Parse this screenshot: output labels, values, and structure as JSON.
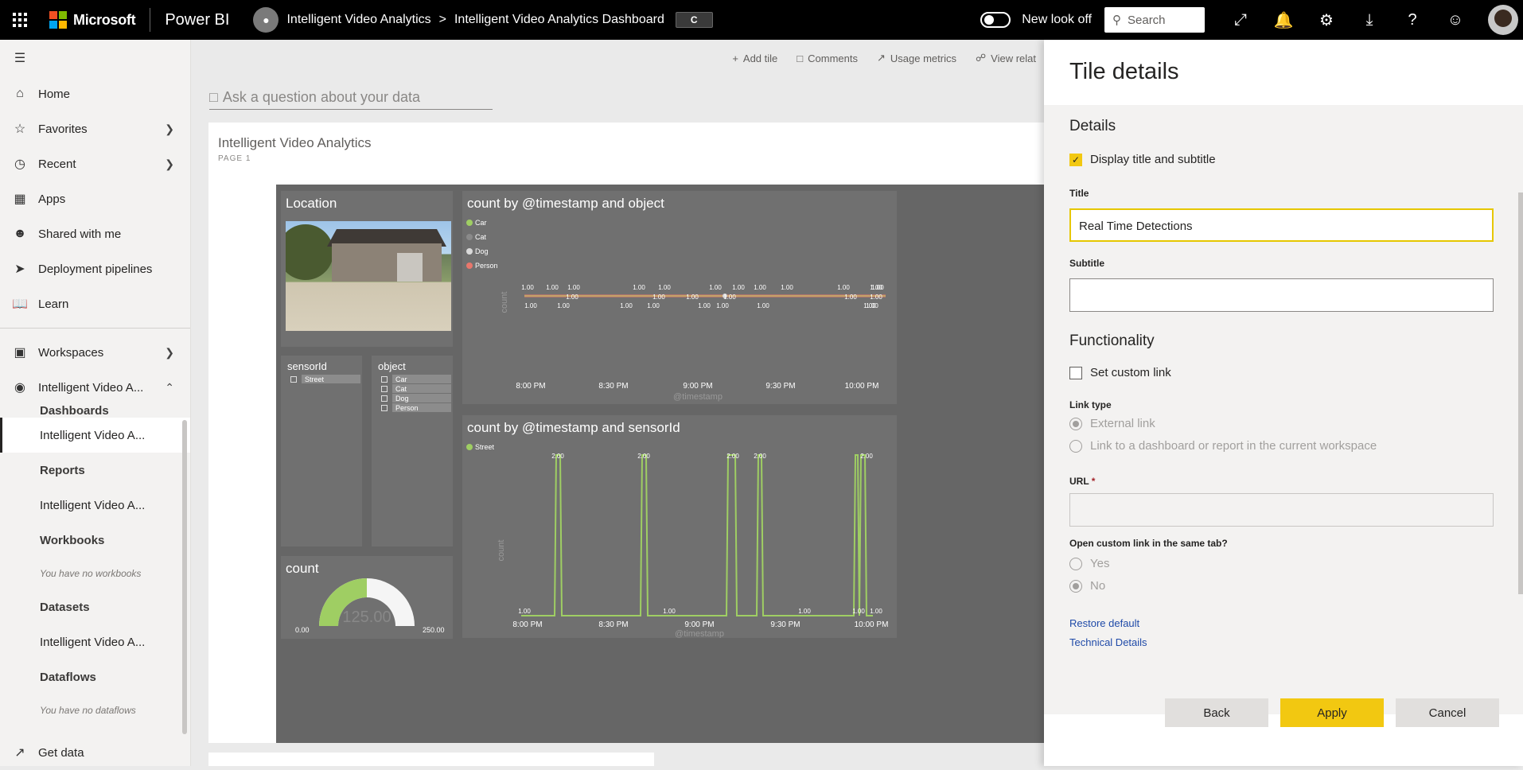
{
  "topbar": {
    "brand": "Microsoft",
    "product": "Power BI",
    "workspace": "Intelligent Video Analytics",
    "separator": ">",
    "dashboard": "Intelligent Video Analytics Dashboard",
    "badge": "C",
    "new_look_label": "New look off",
    "search_placeholder": "Search"
  },
  "nav": {
    "home": "Home",
    "favorites": "Favorites",
    "recent": "Recent",
    "apps": "Apps",
    "shared": "Shared with me",
    "pipelines": "Deployment pipelines",
    "learn": "Learn",
    "workspaces": "Workspaces",
    "current_ws": "Intelligent Video A...",
    "dashboards_head": "Dashboards",
    "dashboard_item": "Intelligent Video A...",
    "reports_head": "Reports",
    "report_item": "Intelligent Video A...",
    "workbooks_head": "Workbooks",
    "workbooks_note": "You have no workbooks",
    "datasets_head": "Datasets",
    "dataset_item": "Intelligent Video A...",
    "dataflows_head": "Dataflows",
    "dataflows_note": "You have no dataflows",
    "get_data": "Get data"
  },
  "actions": {
    "add_tile": "Add tile",
    "comments": "Comments",
    "usage": "Usage metrics",
    "view_related": "View relat"
  },
  "ask_placeholder": "Ask a question about your data",
  "report": {
    "title": "Intelligent Video Analytics",
    "page": "PAGE 1",
    "location_title": "Location",
    "sensor_title": "sensorId",
    "sensor_items": [
      "Street"
    ],
    "object_title": "object",
    "object_items": [
      "Car",
      "Cat",
      "Dog",
      "Person"
    ],
    "count_title": "count",
    "gauge_min": "0.00",
    "gauge_max": "250.00",
    "gauge_value_label": "125.00"
  },
  "chart_data": [
    {
      "type": "line",
      "title": "count by @timestamp and object",
      "xlabel": "@timestamp",
      "ylabel": "count",
      "x_ticks": [
        "8:00 PM",
        "8:30 PM",
        "9:00 PM",
        "9:30 PM",
        "10:00 PM"
      ],
      "series": [
        {
          "name": "Car",
          "color": "#9fce63"
        },
        {
          "name": "Cat",
          "color": "#8a8a8a"
        },
        {
          "name": "Dog",
          "color": "#d9d9d9"
        },
        {
          "name": "Person",
          "color": "#e8776c"
        }
      ],
      "upper_point_labels": [
        "1.00",
        "1.00",
        "1.00",
        "1.00",
        "1.00",
        "1.00",
        "1.00",
        "1.00",
        "1.00",
        "1.00",
        "1.00",
        "1.00"
      ],
      "middle_point_labels": [
        "1.00",
        "1.00",
        "1.00",
        "1.00",
        "1.00",
        "1.00"
      ],
      "lower_point_labels": [
        "1.00",
        "1.00",
        "1.00",
        "1.00",
        "1.00",
        "1.00",
        "1.00",
        "1.00",
        "1.00"
      ],
      "legend": "top-left"
    },
    {
      "type": "line",
      "title": "count by @timestamp and sensorId",
      "xlabel": "@timestamp",
      "ylabel": "count",
      "x_ticks": [
        "8:00 PM",
        "8:30 PM",
        "9:00 PM",
        "9:30 PM",
        "10:00 PM"
      ],
      "series": [
        {
          "name": "Street",
          "color": "#9fce63"
        }
      ],
      "peak_labels": [
        "2.00",
        "2.00",
        "2.00",
        "2.00",
        "2.00"
      ],
      "base_labels": [
        "1.00",
        "1.00",
        "1.00",
        "1.00",
        "1.00"
      ],
      "legend": "top-left"
    }
  ],
  "panel": {
    "title": "Tile details",
    "details_head": "Details",
    "display_title_label": "Display title and subtitle",
    "title_label": "Title",
    "title_value": "Real Time Detections",
    "subtitle_label": "Subtitle",
    "subtitle_value": "",
    "functionality_head": "Functionality",
    "custom_link_label": "Set custom link",
    "link_type_label": "Link type",
    "external_link": "External link",
    "internal_link": "Link to a dashboard or report in the current workspace",
    "url_label": "URL",
    "required_mark": "*",
    "same_tab_label": "Open custom link in the same tab?",
    "yes": "Yes",
    "no": "No",
    "restore": "Restore default",
    "technical": "Technical Details",
    "back": "Back",
    "apply": "Apply",
    "cancel": "Cancel"
  }
}
